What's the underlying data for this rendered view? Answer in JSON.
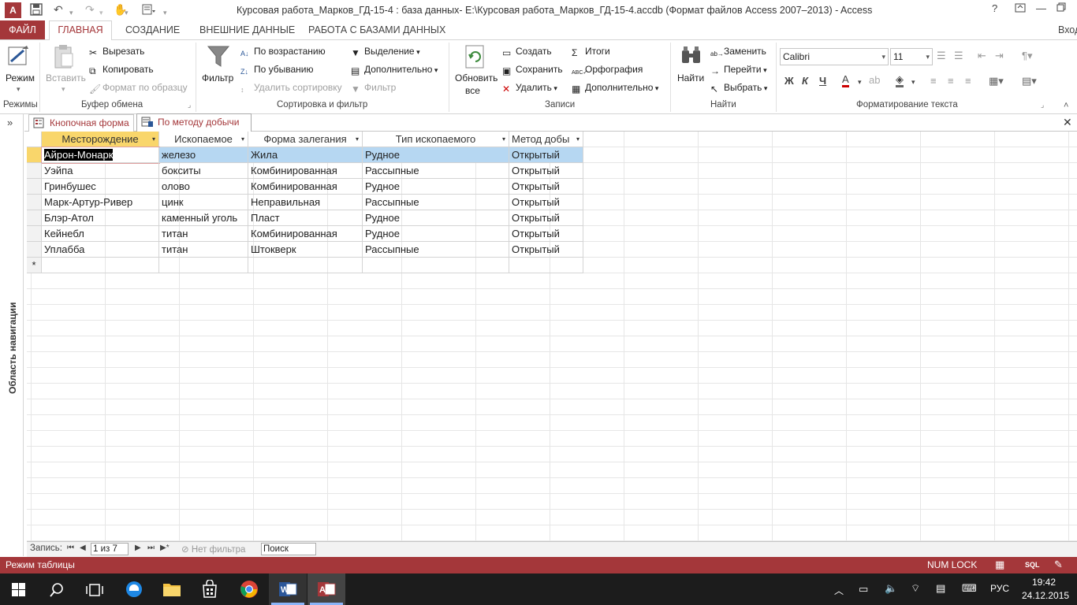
{
  "window": {
    "title": "Курсовая работа_Марков_ГД-15-4 : база данных- E:\\Курсовая работа_Марков_ГД-15-4.accdb (Формат файлов Access 2007–2013) - Access",
    "help": "?",
    "signin": "Вход"
  },
  "ribbon_tabs": {
    "file": "ФАЙЛ",
    "home": "ГЛАВНАЯ",
    "create": "СОЗДАНИЕ",
    "external": "ВНЕШНИЕ ДАННЫЕ",
    "database": "РАБОТА С БАЗАМИ ДАННЫХ"
  },
  "groups": {
    "views": {
      "label": "Режимы",
      "view": "Режим"
    },
    "clipboard": {
      "label": "Буфер обмена",
      "paste": "Вставить",
      "cut": "Вырезать",
      "copy": "Копировать",
      "format_painter": "Формат по образцу"
    },
    "sort_filter": {
      "label": "Сортировка и фильтр",
      "filter": "Фильтр",
      "ascending": "По возрастанию",
      "descending": "По убыванию",
      "remove_sort": "Удалить сортировку",
      "selection": "Выделение",
      "advanced": "Дополнительно",
      "toggle_filter": "Фильтр"
    },
    "records": {
      "label": "Записи",
      "refresh1": "Обновить",
      "refresh2": "все",
      "new": "Создать",
      "save": "Сохранить",
      "delete": "Удалить",
      "totals": "Итоги",
      "spelling": "Орфография",
      "more": "Дополнительно"
    },
    "find": {
      "label": "Найти",
      "find": "Найти",
      "replace": "Заменить",
      "goto": "Перейти",
      "select": "Выбрать"
    },
    "text_format": {
      "label": "Форматирование текста",
      "font": "Calibri",
      "size": "11",
      "bold": "Ж",
      "italic": "К",
      "underline": "Ч"
    }
  },
  "navpane": {
    "label": "Область навигации",
    "toggle": "»"
  },
  "doc_tabs": [
    {
      "label": "Кнопочная форма"
    },
    {
      "label": "По методу  добычи"
    }
  ],
  "table": {
    "columns": [
      "Месторождение",
      "Ископаемое",
      "Форма залегания",
      "Тип ископаемого",
      "Метод добы"
    ],
    "rows": [
      [
        "Айрон-Монарк",
        "железо",
        "Жила",
        "Рудное",
        "Открытый"
      ],
      [
        "Уэйпа",
        "бокситы",
        "Комбинированная",
        "Рассыпные",
        "Открытый"
      ],
      [
        "Гринбушес",
        "олово",
        "Комбинированная",
        "Рудное",
        "Открытый"
      ],
      [
        "Марк-Артур-Ривер",
        "цинк",
        "Неправильная",
        "Рассыпные",
        "Открытый"
      ],
      [
        "Блэр-Атол",
        "каменный уголь",
        "Пласт",
        "Рудное",
        "Открытый"
      ],
      [
        "Кейнебл",
        "титан",
        "Комбинированная",
        "Рудное",
        "Открытый"
      ],
      [
        "Уплабба",
        "титан",
        "Штокверк",
        "Рассыпные",
        "Открытый"
      ]
    ],
    "new_row_marker": "*"
  },
  "record_nav": {
    "label": "Запись:",
    "position": "1 из 7",
    "filter": "Нет фильтра",
    "search_placeholder": "Поиск"
  },
  "status": {
    "mode": "Режим таблицы",
    "numlock": "NUM LOCK",
    "sql": "SQL"
  },
  "taskbar": {
    "lang": "РУС",
    "time": "19:42",
    "date": "24.12.2015"
  },
  "colors": {
    "accent": "#a4373a",
    "selected_row": "#b6d7f2",
    "header_active": "#f9d66b"
  }
}
